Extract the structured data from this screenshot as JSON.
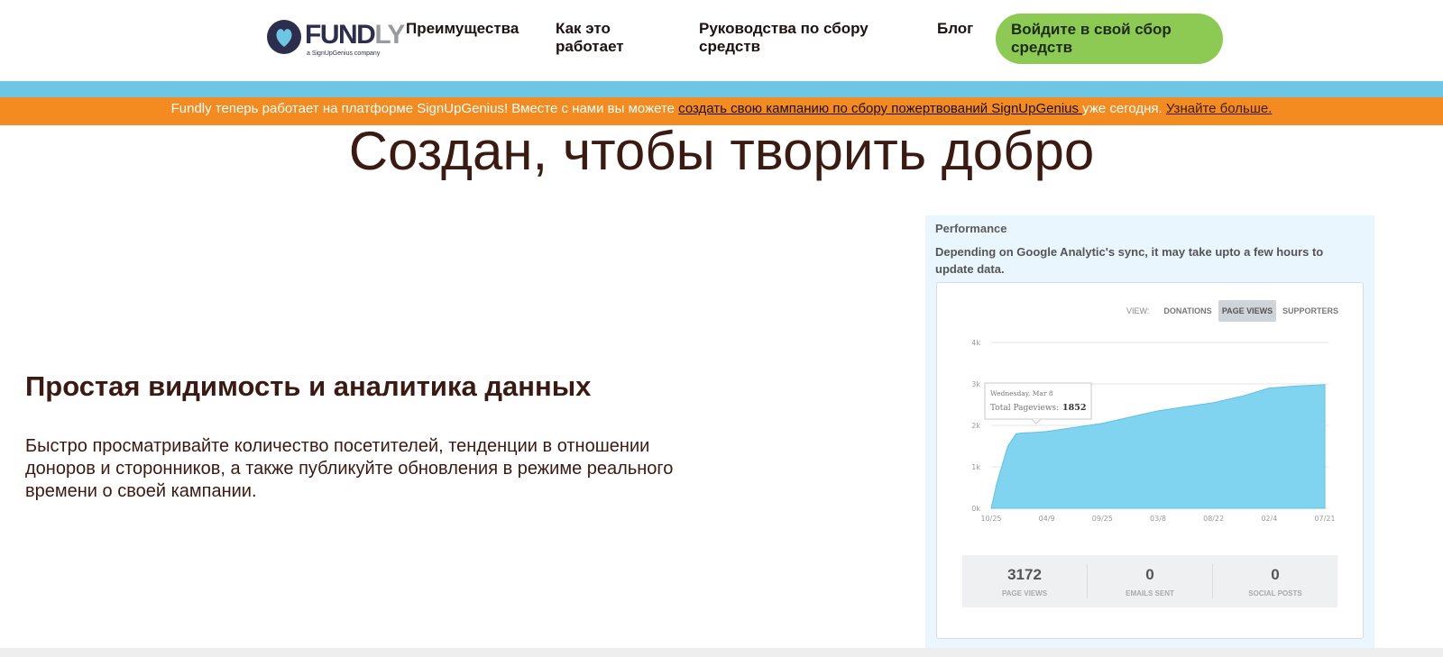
{
  "header": {
    "logo": {
      "word_main": "FUNDLY",
      "word_main_a": "FUND",
      "word_main_b": "LY",
      "sub": "a SignUpGenius company"
    },
    "nav": [
      {
        "label": "Преимущества"
      },
      {
        "label": "Как это работает"
      },
      {
        "label": "Руководства по сбору средств"
      },
      {
        "label": "Блог"
      }
    ],
    "cta_label": "Войдите в свой сбор средств"
  },
  "colors": {
    "accent_blue": "#6cc6e4",
    "banner_orange": "#f48b20",
    "cta_green": "#8dca53",
    "text_brown": "#3b1a12"
  },
  "banner": {
    "prefix": "Fundly теперь работает на платформе SignUpGenius! Вместе с нами вы можете ",
    "link_create": "создать свою кампанию по сбору пожертвований SignUpGenius ",
    "middle": " уже сегодня. ",
    "link_more": "Узнайте больше."
  },
  "hero": {
    "title": "Создан, чтобы творить добро"
  },
  "feature": {
    "title": "Простая видимость и аналитика данных",
    "description": "Быстро просматривайте количество посетителей, тенденции в отношении доноров и сторонников, а также публикуйте обновления в режиме реального времени о своей кампании."
  },
  "dashboard": {
    "section_title": "Performance",
    "note": "Depending on Google Analytic's sync, it may take upto a few hours to update data.",
    "view_label": "VIEW:",
    "tabs": [
      {
        "label": "DONATIONS",
        "active": false
      },
      {
        "label": "PAGE VIEWS",
        "active": true
      },
      {
        "label": "SUPPORTERS",
        "active": false
      }
    ],
    "tooltip": {
      "date": "Wednesday, Mar 8",
      "label": "Total Pageviews:",
      "value": "1852"
    },
    "stats": [
      {
        "value": "3172",
        "label": "PAGE VIEWS"
      },
      {
        "value": "0",
        "label": "EMAILS SENT"
      },
      {
        "value": "0",
        "label": "SOCIAL POSTS"
      }
    ]
  },
  "chart_data": {
    "type": "area",
    "title": "",
    "xlabel": "",
    "ylabel": "",
    "ylim": [
      0,
      4000
    ],
    "y_ticks": [
      "0k",
      "1k",
      "2k",
      "3k",
      "4k"
    ],
    "x_ticks": [
      "10/25",
      "04/9",
      "09/25",
      "03/8",
      "08/22",
      "02/4",
      "07/21"
    ],
    "grid": true,
    "color": "#80d4f0",
    "series": [
      {
        "x": [
          0,
          0.1,
          0.3,
          0.45,
          0.6,
          0.8,
          1.0,
          1.5,
          2.0,
          2.5,
          3.0,
          3.5,
          4.0,
          4.5,
          5.0,
          5.5,
          6.0
        ],
        "values": [
          0,
          600,
          1500,
          1800,
          1820,
          1830,
          1852,
          1950,
          2050,
          2200,
          2350,
          2450,
          2550,
          2700,
          2900,
          2950,
          2980
        ]
      }
    ]
  }
}
